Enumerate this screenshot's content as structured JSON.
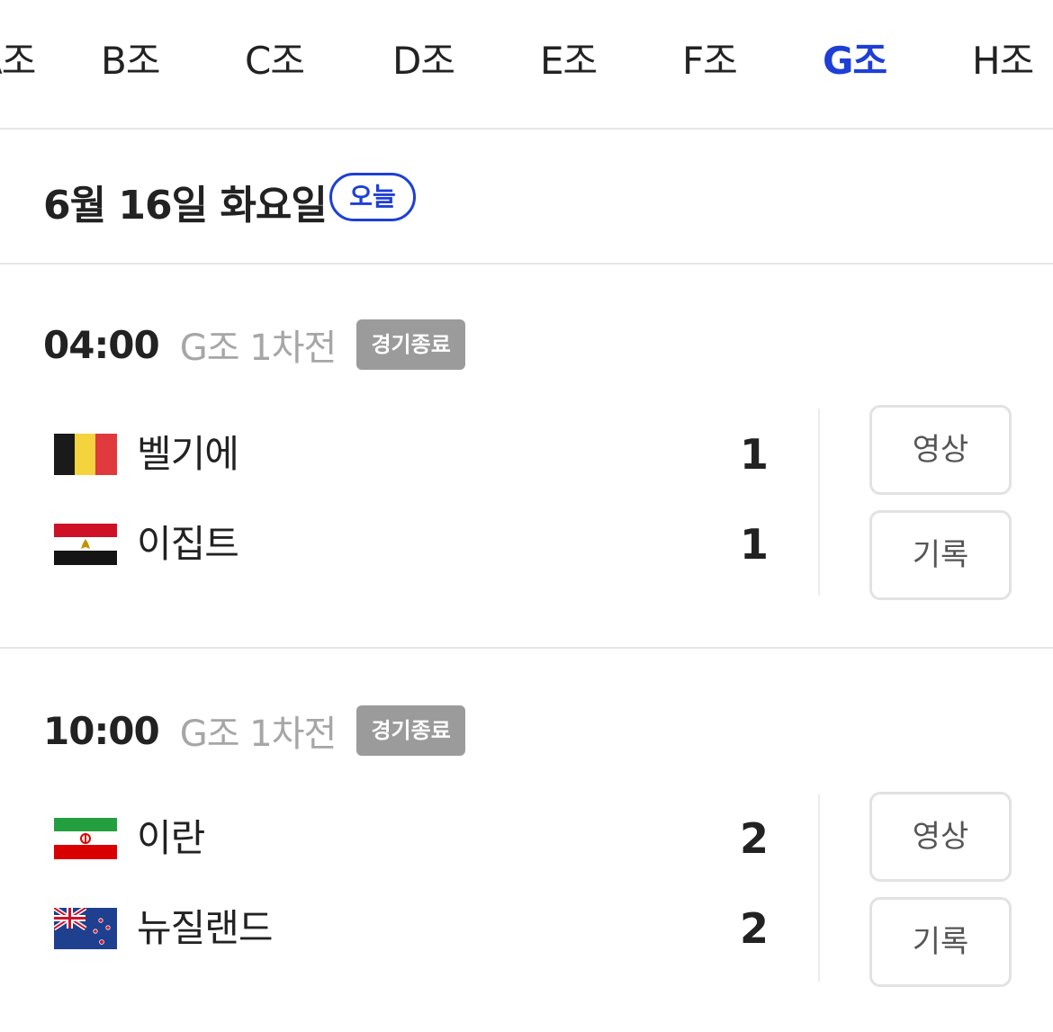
{
  "tabs": [
    {
      "label": "A조"
    },
    {
      "label": "B조"
    },
    {
      "label": "C조"
    },
    {
      "label": "D조"
    },
    {
      "label": "E조"
    },
    {
      "label": "F조"
    },
    {
      "label": "G조",
      "active": true
    },
    {
      "label": "H조"
    }
  ],
  "date": {
    "label": "6월 16일 화요일",
    "badge": "오늘"
  },
  "matches": [
    {
      "time": "04:00",
      "round": "G조 1차전",
      "status": "경기종료",
      "teams": [
        {
          "name": "벨기에",
          "score": "1",
          "flag_icon": "belgium-flag-icon"
        },
        {
          "name": "이집트",
          "score": "1",
          "flag_icon": "egypt-flag-icon"
        }
      ],
      "buttons": {
        "video": "영상",
        "record": "기록"
      }
    },
    {
      "time": "10:00",
      "round": "G조 1차전",
      "status": "경기종료",
      "teams": [
        {
          "name": "이란",
          "score": "2",
          "flag_icon": "iran-flag-icon"
        },
        {
          "name": "뉴질랜드",
          "score": "2",
          "flag_icon": "new-zealand-flag-icon"
        }
      ],
      "buttons": {
        "video": "영상",
        "record": "기록"
      }
    }
  ],
  "colors": {
    "accent": "#1d3fd6",
    "status_badge": "#9b9b9b",
    "muted_text": "#a6a6a6",
    "divider": "#e6e6e6"
  }
}
